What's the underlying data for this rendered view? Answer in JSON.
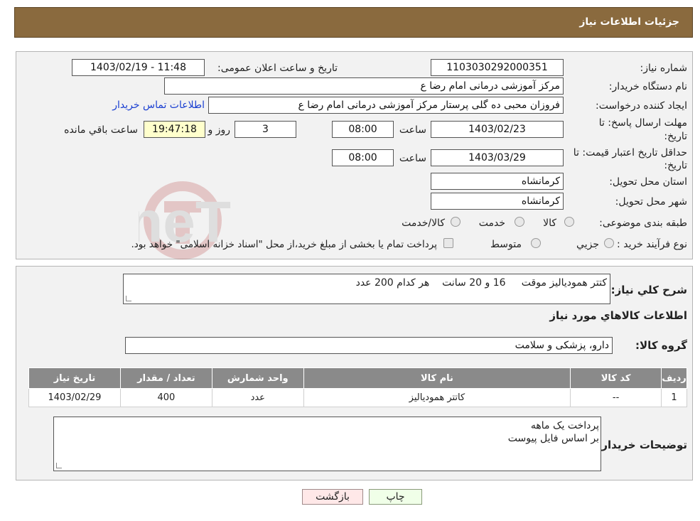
{
  "header": {
    "title": "جزئیات اطلاعات نیاز"
  },
  "watermark": {
    "text": "AriaTender.neT"
  },
  "fields": {
    "need_number_label": "شماره نیاز:",
    "need_number": "1103030292000351",
    "announce_label": "تاریخ و ساعت اعلان عمومی:",
    "announce_value": "1403/02/19 - 11:48",
    "buyer_org_label": "نام دستگاه خریدار:",
    "buyer_org": "مرکز آموزشی  درمانی امام رضا  ع",
    "creator_label": "ایجاد کننده درخواست:",
    "creator": "فروزان محبی ده گلی پرستار مرکز آموزشی  درمانی امام رضا  ع",
    "contact_link": "اطلاعات تماس خریدار",
    "deadline_label_1": "مهلت ارسال پاسخ: تا",
    "deadline_label_2": "تاریخ:",
    "deadline_date": "1403/02/23",
    "time_label": "ساعت",
    "deadline_time": "08:00",
    "days_value": "3",
    "days_label": "روز و",
    "remaining_time": "19:47:18",
    "remaining_label": "ساعت باقي مانده",
    "validity_label_1": "حداقل تاریخ اعتبار قیمت: تا",
    "validity_label_2": "تاریخ:",
    "validity_date": "1403/03/29",
    "validity_time": "08:00",
    "province_label": "استان محل تحویل:",
    "province": "کرمانشاه",
    "city_label": "شهر محل تحویل:",
    "city": "کرمانشاه",
    "category_label": "طبقه بندی موضوعی:",
    "category_options": [
      "کالا",
      "خدمت",
      "کالا/خدمت"
    ],
    "purchase_type_label": "نوع فرآیند خرید :",
    "purchase_options": [
      "جزیي",
      "متوسط"
    ],
    "purchase_note": "پرداخت تمام یا بخشی از مبلغ خرید،از محل \"اسناد خزانه اسلامی\" خواهد بود."
  },
  "details": {
    "summary_label": "شرح کلي نياز:",
    "summary": "کتتر همودیالیز موقت     16 و 20 سانت    هر کدام 200 عدد",
    "goods_info_title": "اطلاعات کالاهاي مورد نياز",
    "goods_group_label": "گروه کالا:",
    "goods_group": "دارو، پزشکی و سلامت",
    "table": {
      "headers": [
        "رديف",
        "کد کالا",
        "نام کالا",
        "واحد شمارش",
        "تعداد / مقدار",
        "تاریخ نیاز"
      ],
      "rows": [
        [
          "1",
          "--",
          "کاتتر همودیالیز",
          "عدد",
          "400",
          "1403/02/29"
        ]
      ]
    },
    "buyer_notes_label": "توضیحات خریدار:",
    "buyer_notes_line1": "پرداخت یک ماهه",
    "buyer_notes_line2": "بر اساس فایل پیوست"
  },
  "buttons": {
    "print": "چاپ",
    "back": "بازگشت"
  }
}
